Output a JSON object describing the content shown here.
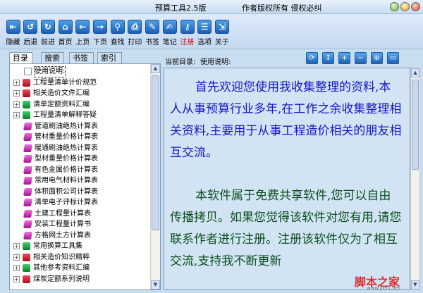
{
  "window": {
    "title": "预算工具2.5版",
    "copyright": "作者版权所有  侵权必纠"
  },
  "toolbar": [
    {
      "label": "隐藏",
      "icon": "hide-icon",
      "glyph": "⇤",
      "red": false
    },
    {
      "label": "后退",
      "icon": "back-refresh-icon",
      "glyph": "↺",
      "red": false
    },
    {
      "label": "前进",
      "icon": "forward-refresh-icon",
      "glyph": "↻",
      "red": false
    },
    {
      "label": "首页",
      "icon": "home-icon",
      "glyph": "⌂",
      "red": false
    },
    {
      "label": "上页",
      "icon": "arrow-left-icon",
      "glyph": "←",
      "red": false
    },
    {
      "label": "下页",
      "icon": "arrow-right-icon",
      "glyph": "→",
      "red": false
    },
    {
      "label": "查找",
      "icon": "search-icon",
      "glyph": "⚲",
      "red": false
    },
    {
      "label": "打印",
      "icon": "printer-icon",
      "glyph": "⎙",
      "red": false
    },
    {
      "label": "书签",
      "icon": "bookmark-icon",
      "glyph": "✎",
      "red": false
    },
    {
      "label": "笔记",
      "icon": "note-icon",
      "glyph": "✍",
      "red": false
    },
    {
      "label": "注册",
      "icon": "key-icon",
      "glyph": "⚷",
      "red": true
    },
    {
      "label": "选项",
      "icon": "options-icon",
      "glyph": "☰",
      "red": false
    },
    {
      "label": "关于",
      "icon": "about-icon",
      "glyph": "⇲",
      "red": false
    }
  ],
  "tabs": [
    "目录",
    "搜索",
    "书签",
    "索引"
  ],
  "tree": [
    {
      "label": "使用说明:",
      "icon": "page",
      "expander": "",
      "depth": 1,
      "selected": true
    },
    {
      "label": "工程量清单计价规范",
      "icon": "red",
      "expander": "+",
      "depth": 0,
      "selected": false
    },
    {
      "label": "相关造价文件汇编",
      "icon": "red",
      "expander": "+",
      "depth": 0,
      "selected": false
    },
    {
      "label": "清单定额资料汇编",
      "icon": "green",
      "expander": "+",
      "depth": 0,
      "selected": false
    },
    {
      "label": "工程量清单解释答疑",
      "icon": "green",
      "expander": "+",
      "depth": 0,
      "selected": false
    },
    {
      "label": "管道刷油绝热计算表",
      "icon": "pink",
      "expander": "",
      "depth": 1,
      "selected": false
    },
    {
      "label": "管材重量价格计算表",
      "icon": "pink",
      "expander": "",
      "depth": 1,
      "selected": false
    },
    {
      "label": "暖通刷油绝热计算表",
      "icon": "pink",
      "expander": "",
      "depth": 1,
      "selected": false
    },
    {
      "label": "型材重量价格计算表",
      "icon": "pink",
      "expander": "",
      "depth": 1,
      "selected": false
    },
    {
      "label": "有色金属价格计算表",
      "icon": "pink",
      "expander": "",
      "depth": 1,
      "selected": false
    },
    {
      "label": "常用电气材料计算表",
      "icon": "pink",
      "expander": "",
      "depth": 1,
      "selected": false
    },
    {
      "label": "体积面积公司计算表",
      "icon": "pink",
      "expander": "",
      "depth": 1,
      "selected": false
    },
    {
      "label": "清单电子评标计算表",
      "icon": "pink",
      "expander": "",
      "depth": 1,
      "selected": false
    },
    {
      "label": "土建工程量计算表",
      "icon": "pink",
      "expander": "",
      "depth": 1,
      "selected": false
    },
    {
      "label": "安装工程量计算书",
      "icon": "pink",
      "expander": "",
      "depth": 1,
      "selected": false
    },
    {
      "label": "方格网土方计算表",
      "icon": "pink",
      "expander": "",
      "depth": 1,
      "selected": false
    },
    {
      "label": "常用换算工具集",
      "icon": "green",
      "expander": "+",
      "depth": 0,
      "selected": false
    },
    {
      "label": "相关造价知识精粹",
      "icon": "red",
      "expander": "+",
      "depth": 0,
      "selected": false
    },
    {
      "label": "其他参考资料汇编",
      "icon": "green",
      "expander": "+",
      "depth": 0,
      "selected": false
    },
    {
      "label": "煤炭定额系列说明",
      "icon": "red",
      "expander": "+",
      "depth": 0,
      "selected": false
    }
  ],
  "content": {
    "current_dir_label": "当前目录:",
    "current_dir_value": "使用说明:",
    "buttons": [
      {
        "icon": "sync-icon",
        "glyph": "⟳"
      },
      {
        "icon": "scroll-icon",
        "glyph": "↕"
      },
      {
        "icon": "zoom-in-icon",
        "glyph": "+"
      },
      {
        "icon": "zoom-out-icon",
        "glyph": "−"
      },
      {
        "icon": "zoom-fit-icon",
        "glyph": "⊕"
      },
      {
        "icon": "fullscreen-icon",
        "glyph": "▭"
      }
    ],
    "para1": "首先欢迎您使用我收集整理的资料,本人从事预算行业多年,在工作之余收集整理相关资料,主要用于从事工程造价相关的朋友相互交流。",
    "para2": "本软件属于免费共享软件,您可以自由传播拷贝。如果您觉得该软件对您有用,请您联系作者进行注册。注册该软件仅为了相互交流,支持我不断更新"
  },
  "watermark": "脚本之家",
  "watermark_sub": "www.jb51.net"
}
